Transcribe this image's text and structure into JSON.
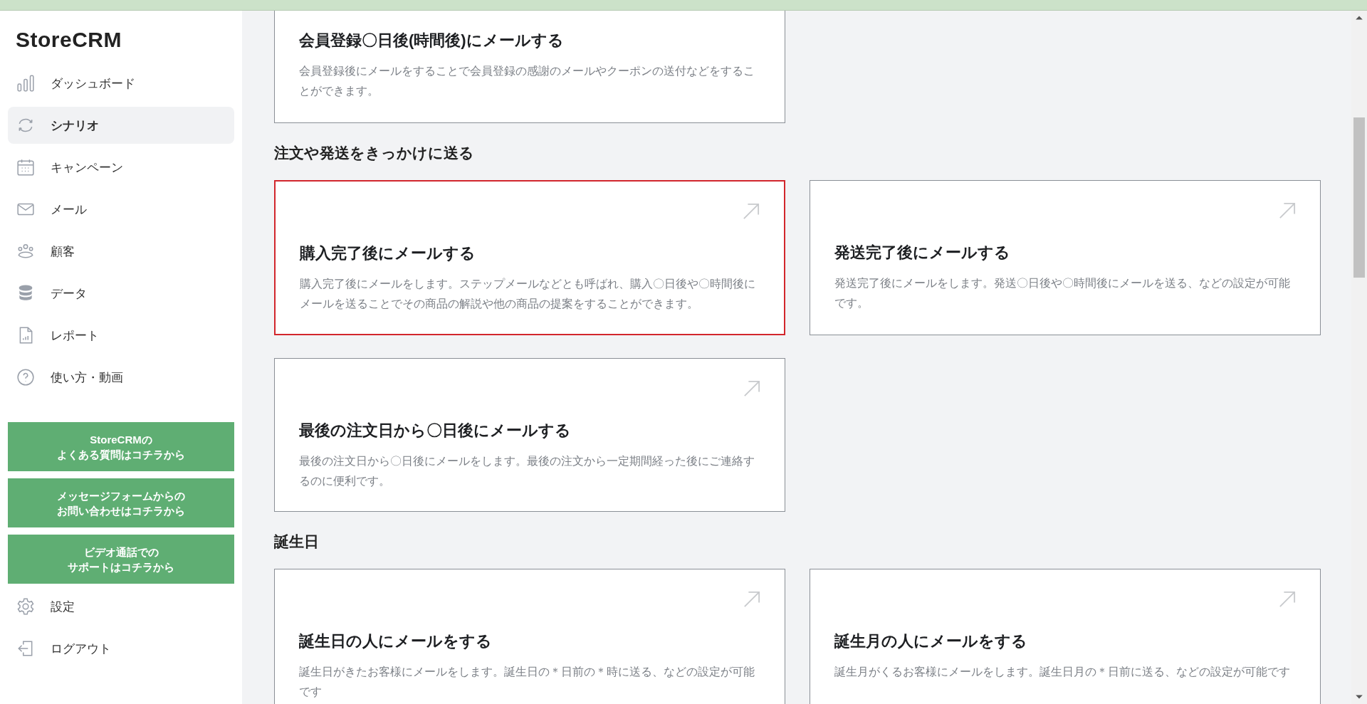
{
  "sidebar": {
    "logo": "StoreCRM",
    "items": [
      {
        "label": "ダッシュボード",
        "selected": false
      },
      {
        "label": "シナリオ",
        "selected": true
      },
      {
        "label": "キャンペーン",
        "selected": false
      },
      {
        "label": "メール",
        "selected": false
      },
      {
        "label": "顧客",
        "selected": false
      },
      {
        "label": "データ",
        "selected": false
      },
      {
        "label": "レポート",
        "selected": false
      },
      {
        "label": "使い方・動画",
        "selected": false
      }
    ],
    "help_buttons": [
      [
        "StoreCRMの",
        "よくある質問はコチラから"
      ],
      [
        "メッセージフォームからの",
        "お問い合わせはコチラから"
      ],
      [
        "ビデオ通話での",
        "サポートはコチラから"
      ]
    ],
    "bottom_items": [
      {
        "label": "設定"
      },
      {
        "label": "ログアウト"
      }
    ]
  },
  "partial_card": {
    "title": "会員登録〇日後(時間後)にメールする",
    "description": "会員登録後にメールをすることで会員登録の感謝のメールやクーポンの送付などをすることができます。"
  },
  "sections": [
    {
      "heading": "注文や発送をきっかけに送る",
      "cards": [
        {
          "title": "購入完了後にメールする",
          "description": "購入完了後にメールをします。ステップメールなどとも呼ばれ、購入〇日後や〇時間後にメールを送ることでその商品の解説や他の商品の提案をすることができます。",
          "highlighted": true
        },
        {
          "title": "発送完了後にメールする",
          "description": "発送完了後にメールをします。発送〇日後や〇時間後にメールを送る、などの設定が可能です。",
          "highlighted": false
        },
        {
          "title": "最後の注文日から〇日後にメールする",
          "description": "最後の注文日から〇日後にメールをします。最後の注文から一定期間経った後にご連絡するのに便利です。",
          "highlighted": false
        }
      ]
    },
    {
      "heading": "誕生日",
      "cards": [
        {
          "title": "誕生日の人にメールをする",
          "description": "誕生日がきたお客様にメールをします。誕生日の＊日前の＊時に送る、などの設定が可能です",
          "highlighted": false
        },
        {
          "title": "誕生月の人にメールをする",
          "description": "誕生月がくるお客様にメールをします。誕生日月の＊日前に送る、などの設定が可能です",
          "highlighted": false
        }
      ]
    }
  ]
}
